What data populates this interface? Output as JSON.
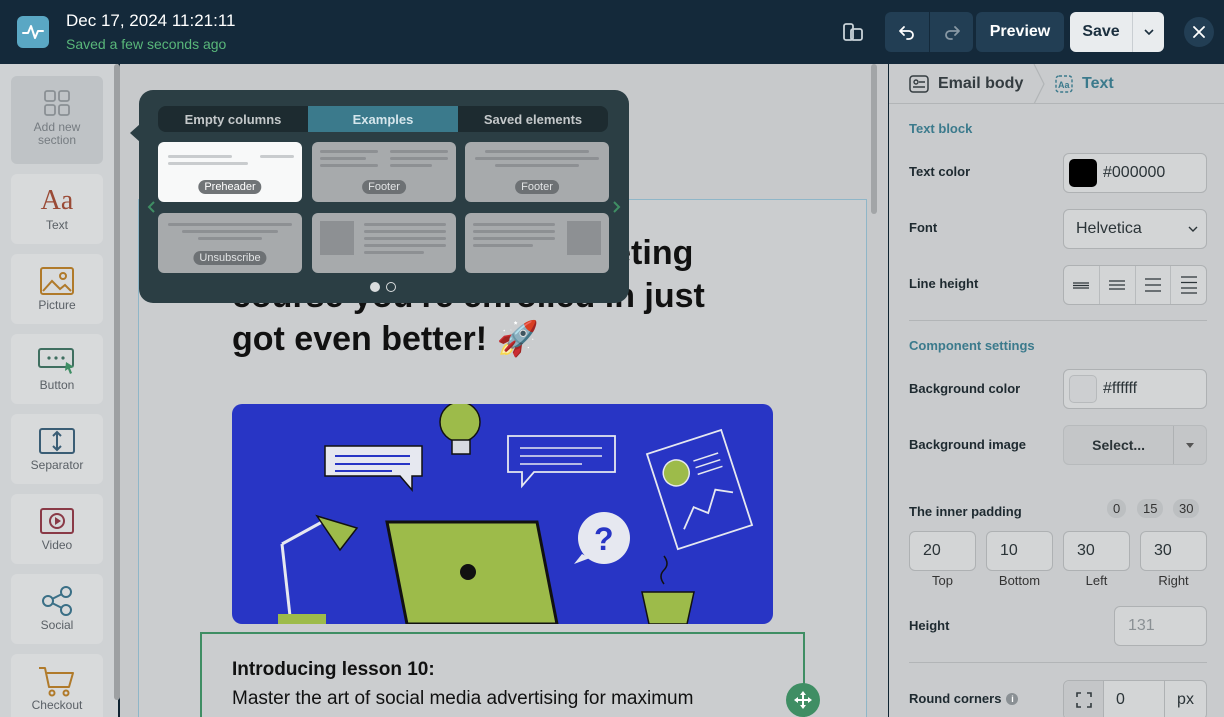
{
  "header": {
    "title": "Dec 17, 2024 11:21:11",
    "status": "Saved a few seconds ago",
    "preview_label": "Preview",
    "save_label": "Save"
  },
  "sidebar": {
    "items": [
      {
        "label": "Add new section",
        "icon": "grid-icon"
      },
      {
        "label": "Text",
        "icon": "text-aa-icon"
      },
      {
        "label": "Picture",
        "icon": "picture-icon"
      },
      {
        "label": "Button",
        "icon": "button-icon"
      },
      {
        "label": "Separator",
        "icon": "separator-icon"
      },
      {
        "label": "Video",
        "icon": "video-icon"
      },
      {
        "label": "Social",
        "icon": "share-icon"
      },
      {
        "label": "Checkout",
        "icon": "cart-icon"
      }
    ]
  },
  "popup": {
    "tabs": [
      "Empty columns",
      "Examples",
      "Saved elements"
    ],
    "selected_tab": "Examples",
    "thumbnails": [
      {
        "tag": "Preheader",
        "selected": true
      },
      {
        "tag": "Footer"
      },
      {
        "tag": "Footer"
      },
      {
        "tag": "Unsubscribe"
      },
      {
        "tag": ""
      },
      {
        "tag": ""
      }
    ],
    "pages": 2,
    "current_page": 1
  },
  "email": {
    "headline_line1": "rketing",
    "headline_line2": "course you're enrolled in just",
    "headline_line3": "got even better! 🚀",
    "lesson_title": "Introducing lesson 10:",
    "lesson_text": "Master the art of social media advertising for maximum"
  },
  "panel": {
    "breadcrumb_root": "Email body",
    "breadcrumb_current": "Text",
    "text_block_title": "Text block",
    "text_color_label": "Text color",
    "text_color_value": "#000000",
    "font_label": "Font",
    "font_value": "Helvetica",
    "line_height_label": "Line height",
    "component_settings_title": "Component settings",
    "bg_color_label": "Background color",
    "bg_color_value": "#ffffff",
    "bg_image_label": "Background image",
    "bg_image_button": "Select...",
    "inner_padding_label": "The inner padding",
    "padding_presets": [
      "0",
      "15",
      "30"
    ],
    "padding": [
      {
        "value": "20",
        "caption": "Top"
      },
      {
        "value": "10",
        "caption": "Bottom"
      },
      {
        "value": "30",
        "caption": "Left"
      },
      {
        "value": "30",
        "caption": "Right"
      }
    ],
    "height_label": "Height",
    "height_placeholder": "131",
    "round_corners_label": "Round corners",
    "round_corners_value": "0",
    "round_corners_unit": "px"
  },
  "colors": {
    "accent": "#3b7a8c",
    "success": "#59b77a",
    "topbar": "#14293a"
  }
}
